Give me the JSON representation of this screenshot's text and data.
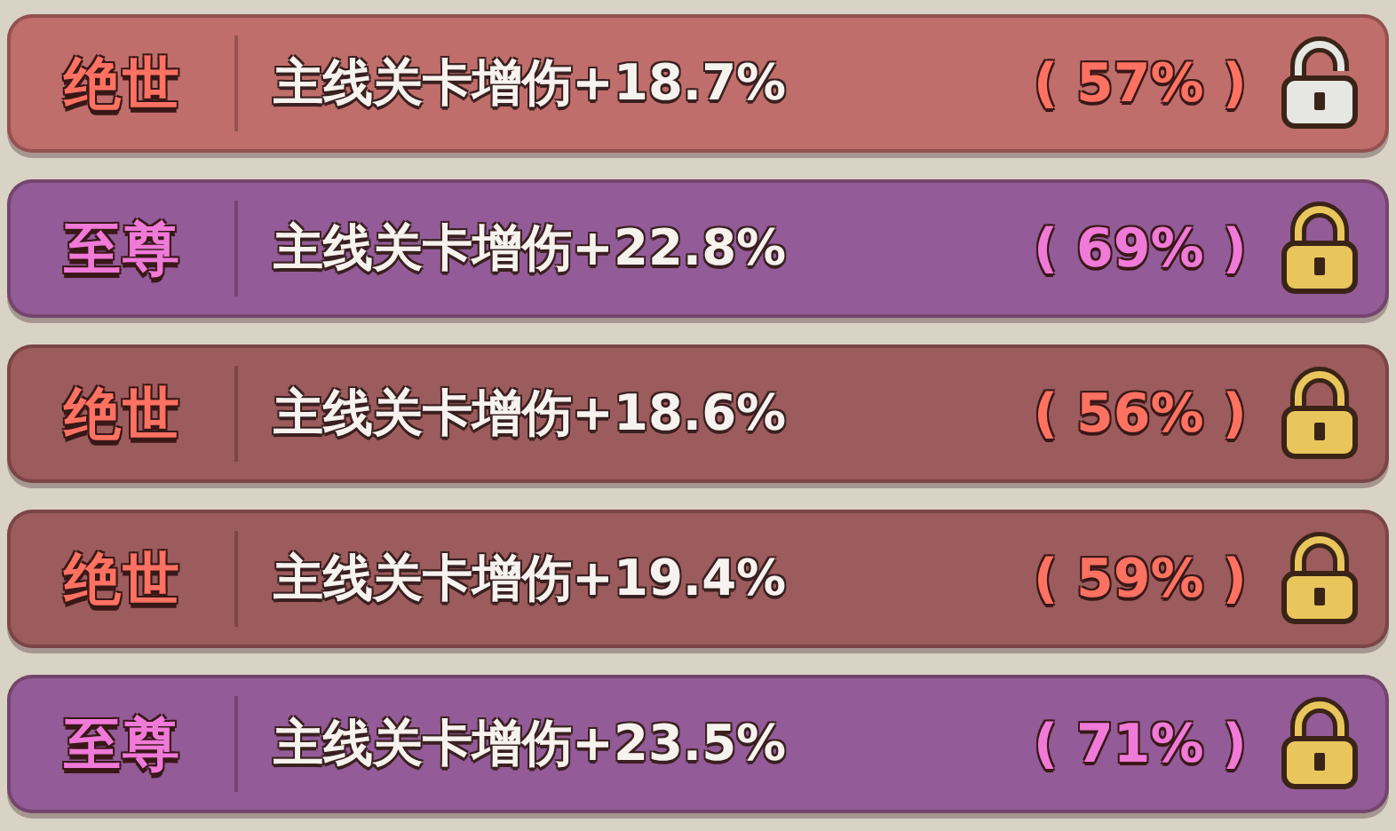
{
  "rows": [
    {
      "tier": "绝世",
      "kind": "jueshi",
      "bonus": "主线关卡增伤+18.7%",
      "percent": "( 57% )",
      "locked": false,
      "color": "#c06e6b"
    },
    {
      "tier": "至尊",
      "kind": "zhizun",
      "bonus": "主线关卡增伤+22.8%",
      "percent": "( 69% )",
      "locked": true,
      "color": "#935b97"
    },
    {
      "tier": "绝世",
      "kind": "jueshi",
      "bonus": "主线关卡增伤+18.6%",
      "percent": "( 56% )",
      "locked": true,
      "color": "#9c5b5c"
    },
    {
      "tier": "绝世",
      "kind": "jueshi",
      "bonus": "主线关卡增伤+19.4%",
      "percent": "( 59% )",
      "locked": true,
      "color": "#9c5b5c"
    },
    {
      "tier": "至尊",
      "kind": "zhizun",
      "bonus": "主线关卡增伤+23.5%",
      "percent": "( 71% )",
      "locked": true,
      "color": "#935b97"
    }
  ]
}
